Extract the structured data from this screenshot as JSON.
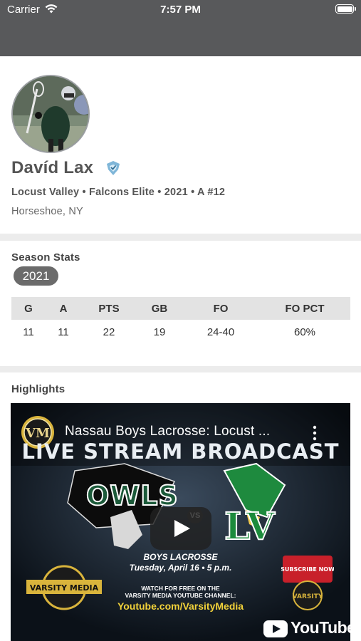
{
  "status_bar": {
    "carrier": "Carrier",
    "time": "7:57 PM",
    "background_color": "#58595b"
  },
  "profile": {
    "name": "Davíd Lax",
    "verified_icon": "verified-badge-icon",
    "subline": "Locust Valley • Falcons Elite • 2021 • A #12",
    "location": "Horseshoe, NY"
  },
  "season_stats": {
    "title": "Season Stats",
    "selected_year": "2021",
    "columns": [
      "G",
      "A",
      "PTS",
      "GB",
      "FO",
      "FO PCT"
    ],
    "rows": [
      [
        "11",
        "11",
        "22",
        "19",
        "24-40",
        "60%"
      ]
    ]
  },
  "highlights": {
    "title": "Highlights",
    "video": {
      "title": "Nassau Boys Lacrosse: Locust ...",
      "channel_logo_text": "VM",
      "banner": "LIVE STREAM BROADCAST",
      "team_1": "OWLS",
      "vs": "VS",
      "team_2": "LV",
      "event_line_1": "BOYS LACROSSE",
      "event_line_2": "Tuesday, April 16 • 5 p.m.",
      "watch_line_1": "WATCH FOR FREE ON THE",
      "watch_line_2": "VARSITY MEDIA YOUTUBE CHANNEL:",
      "url": "Youtube.com/VarsityMedia",
      "left_logo_text": "VARSITY MEDIA",
      "subscribe_text": "SUBSCRIBE NOW",
      "subscribe_logo_text": "VARSITY",
      "brand": "YouTube"
    }
  }
}
